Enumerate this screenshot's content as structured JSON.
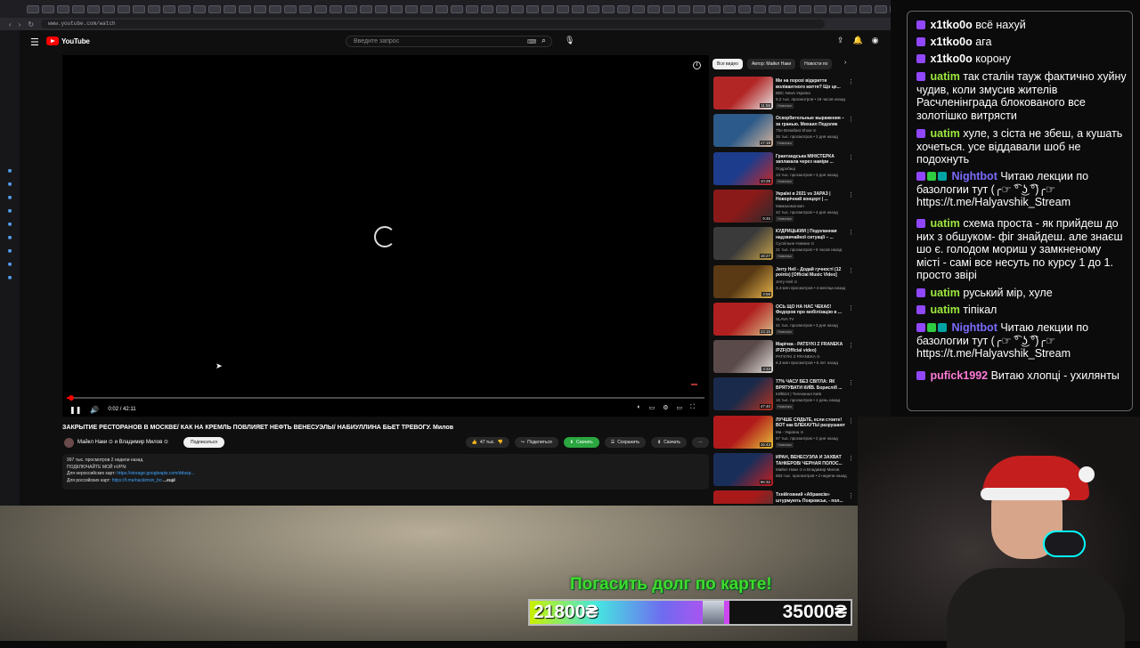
{
  "browser": {
    "url": "www.youtube.com/watch"
  },
  "youtube": {
    "logo_text": "YouTube",
    "search_placeholder": "Введите запрос",
    "player": {
      "time": "0:02 / 42:11",
      "progress_fraction": 0.0008
    },
    "video_title": "ЗАКРЫТИЕ РЕСТОРАНОВ В МОСКВЕ/ КАК НА КРЕМЛЬ ПОВЛИЯЕТ НЕФТЬ ВЕНЕСУЭЛЫ/ НАБИУЛЛИНА БЬЕТ ТРЕВОГУ. Милов",
    "channel_name": "Майкл Наки ⊙ и Владимир Милов ⊙",
    "subscribe_label": "Подписаться",
    "likes": "47 тыс.",
    "share_label": "Поделиться",
    "download_green_label": "Скачать",
    "save_label": "Сохранить",
    "download_label": "Скачать",
    "description": {
      "line1": "997 тыс. просмотров  2 недели назад",
      "line2": "ПОДКЛЮЧАЙТЕ МОЙ nVPN:",
      "line3_prefix": "Для нероссийских карт: ",
      "line3_link": "https://storage.googleapis.com/ddasp...",
      "line4_prefix": "Для российских карт: ",
      "line4_link": "https://t.me/nackimon_bo",
      "more_label": "...ещё"
    },
    "chips": [
      "Все видео",
      "Автор: Майкл Наки",
      "Новости по"
    ],
    "recommendations": [
      {
        "title": "Ми на порозі відкриття волівантного життя? Що це...",
        "channel": "BBC News Україна",
        "meta": "9,2 тыс. просмотров • 19 часов назад",
        "badge": "Новинка",
        "duration": "11:56",
        "color1": "#b32626",
        "color2": "#e6e6e6"
      },
      {
        "title": "Оскорбительные выражения – за гранью. Михаил Подоляк",
        "channel": "The Breakfast Show ⊙",
        "meta": "35 тыс. просмотров • 2 дня назад",
        "badge": "Новинка",
        "duration": "17:19",
        "color1": "#2c5a8a",
        "color2": "#d6b59a"
      },
      {
        "title": "Грантандська МІНІСТЕРКА заплакала через наміри ...",
        "channel": "Подробиці",
        "meta": "13 тыс. просмотров • 3 дня назад",
        "badge": "Новинка",
        "duration": "10:28",
        "color1": "#1e3c8c",
        "color2": "#c82828"
      },
      {
        "title": "Україні в 2021 vs ЗАРАЗ | Новорічний концерт | ...",
        "channel": "Мамахомогомп",
        "meta": "42 тыс. просмотров • 4 дня назад",
        "badge": "Новинка",
        "duration": "9:45",
        "color1": "#8a1a1a",
        "color2": "#2a2a2a"
      },
      {
        "title": "КУДРИЦЬКИЙ | Подоланная надзвичайної ситуації – ...",
        "channel": "Суспільне Новини ⊙",
        "meta": "21 тыс. просмотров • 5 часов назад",
        "badge": "Новинка",
        "duration": "18:27",
        "color1": "#3a3a3a",
        "color2": "#c9a44a"
      },
      {
        "title": "Jerry Heil - Додай гучності (12 points) [Official Music Video]",
        "channel": "Jerry Heil ⊙",
        "meta": "3,4 млн просмотров • 4 месяца назад",
        "badge": "",
        "duration": "3:58",
        "color1": "#5a3a14",
        "color2": "#e3b44c"
      },
      {
        "title": "ОСЬ ЩО НА НАС ЧЕКАЄ! Федоров про мобілізацію в ...",
        "channel": "SLAVA TV",
        "meta": "41 тыс. просмотров • 3 дня назад",
        "badge": "Новинка",
        "duration": "23:15",
        "color1": "#b02020",
        "color2": "#d9c08a"
      },
      {
        "title": "Марічка - PATSYKI Z FRANEKA /PZF(Official video)",
        "channel": "PATSYKI Z FRANEKA ⊙",
        "meta": "6,3 млн просмотров • 6 лет назад",
        "badge": "",
        "duration": "3:33",
        "color1": "#5a4a4a",
        "color2": "#e6e0dc"
      },
      {
        "title": "77% ЧАСУ БЕЗ СВІТЛА: ЯК ВРЯТУВАТИ КИЇВ. Борисліб ...",
        "channel": "КИЇВ24 | Телеканал Київ",
        "meta": "16 тыс. просмотров • 1 день назад",
        "badge": "Новинка",
        "duration": "47:40",
        "color1": "#1a2a4a",
        "color2": "#b8321e"
      },
      {
        "title": "ЛУЧШЕ СЯДЬТЕ, если стоите! ВОТ как БЛЕКАУТЫ разрушают ...",
        "channel": "Ми - Україна ⊙",
        "meta": "97 тыс. просмотров • 2 дня назад",
        "badge": "Новинка",
        "duration": "16:43",
        "color1": "#b01a1a",
        "color2": "#e6c23a"
      },
      {
        "title": "ИРАН, ВЕНЕСУЭЛА И ЗАХВАТ ТАНКЕРОВ/ ЧЕРНАЯ ПОЛОС...",
        "channel": "Майкл Наки ⊙ и Владимир Милов",
        "meta": "683 тыс. просмотров • 2 недели назад",
        "badge": "",
        "duration": "56:32",
        "color1": "#1a2e5a",
        "color2": "#c81e1e"
      },
      {
        "title": "Тхнійговний «Абрамсів» штурмують Покровськ, - пол...",
        "channel": "",
        "meta": "",
        "badge": "",
        "duration": "",
        "color1": "#a81a1a",
        "color2": "#3a3a3a"
      }
    ]
  },
  "overlay": {
    "debt_text": "Погасить долг по карте!",
    "goal_current": "21800₴",
    "goal_total": "35000₴",
    "goal_fraction": 0.623
  },
  "chat": [
    {
      "user": "x1tko0o",
      "color": "#ffffff",
      "badges": [
        "sub"
      ],
      "text": "всё нахуй"
    },
    {
      "user": "x1tko0o",
      "color": "#ffffff",
      "badges": [
        "sub"
      ],
      "text": "ага"
    },
    {
      "user": "x1tko0o",
      "color": "#ffffff",
      "badges": [
        "sub"
      ],
      "text": "корону"
    },
    {
      "user": "uatim",
      "color": "#9ee83f",
      "badges": [
        "sub"
      ],
      "text": "так сталін тауж фактично хуйну чудив, коли змусив жителів Расчленінграда блокованого все золотішко витрясти"
    },
    {
      "user": "uatim",
      "color": "#9ee83f",
      "badges": [
        "sub"
      ],
      "text": "хуле, з сіста не збеш, а кушать хочеться. усе віддавали шоб не подохнуть"
    },
    {
      "user": "Nightbot",
      "color": "#7b6cff",
      "badges": [
        "sub",
        "ok",
        "bot"
      ],
      "text": "Читаю лекции по базологии тут (╭☞ ͡° ͜ʖ ͡°)╭☞ https://t.me/Halyavshik_Stream"
    },
    {
      "user": "uatim",
      "color": "#9ee83f",
      "badges": [
        "sub"
      ],
      "text": "схема проста - як прийдеш до них з обшуком- фіг знайдеш. але знаєш шо є. голодом мориш у замкненому місті - самі все несуть по курсу 1 до 1. просто звірі"
    },
    {
      "user": "uatim",
      "color": "#9ee83f",
      "badges": [
        "sub"
      ],
      "text": "руський мір, хуле"
    },
    {
      "user": "uatim",
      "color": "#9ee83f",
      "badges": [
        "sub"
      ],
      "text": "тіпікал"
    },
    {
      "user": "Nightbot",
      "color": "#7b6cff",
      "badges": [
        "sub",
        "ok",
        "bot"
      ],
      "text": "Читаю лекции по базологии тут (╭☞ ͡° ͜ʖ ͡°)╭☞ https://t.me/Halyavshik_Stream"
    },
    {
      "user": "pufick1992",
      "color": "#ff7ad9",
      "badges": [
        "sub"
      ],
      "text": "Витаю хлопці - ухилянты"
    }
  ]
}
